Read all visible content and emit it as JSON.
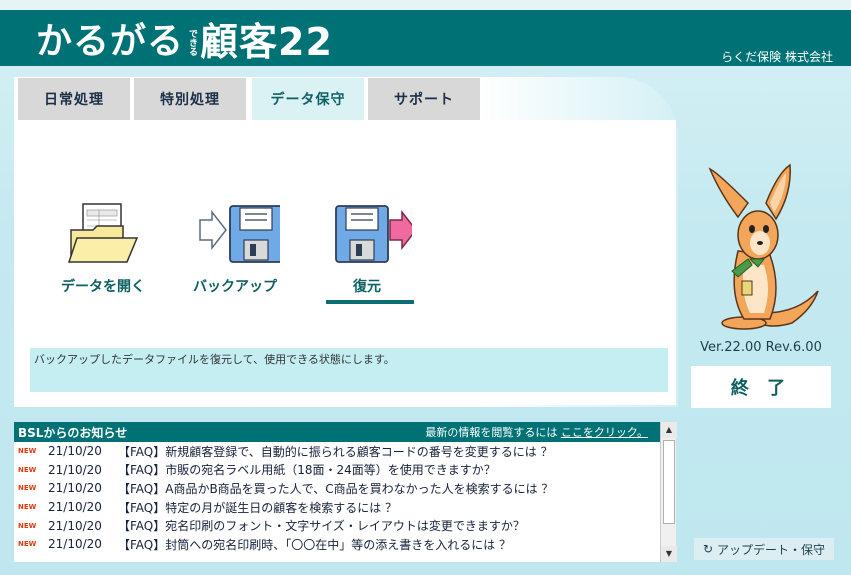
{
  "header": {
    "logo_kana": "かるがる",
    "logo_dekiru": "できる",
    "logo_kanji": "顧客22",
    "company": "らくだ保険 株式会社"
  },
  "tabs": [
    {
      "label": "日常処理"
    },
    {
      "label": "特別処理"
    },
    {
      "label": "データ保守"
    },
    {
      "label": "サポート"
    }
  ],
  "functions": {
    "open": {
      "label": "データを開く"
    },
    "backup": {
      "label": "バックアップ"
    },
    "restore": {
      "label": "復元"
    }
  },
  "description": "バックアップしたデータファイルを復元して、使用できる状態にします。",
  "side": {
    "version": "Ver.22.00 Rev.6.00",
    "exit_label": "終 了",
    "update_label": "アップデート・保守"
  },
  "news": {
    "title": "BSLからのお知らせ",
    "link_prefix": "最新の情報を閲覧するには",
    "link_text": "ここをクリック。",
    "new_badge": "NEW",
    "items": [
      {
        "date": "21/10/20",
        "title": "【FAQ】新規顧客登録で、自動的に振られる顧客コードの番号を変更するには ？"
      },
      {
        "date": "21/10/20",
        "title": "【FAQ】市販の宛名ラベル用紙（18面・24面等）を使用できますか？"
      },
      {
        "date": "21/10/20",
        "title": "【FAQ】A商品かB商品を買った人で、C商品を買わなかった人を検索するには ？"
      },
      {
        "date": "21/10/20",
        "title": "【FAQ】特定の月が誕生日の顧客を検索するには ？"
      },
      {
        "date": "21/10/20",
        "title": "【FAQ】宛名印刷のフォント・文字サイズ・レイアウトは変更できますか？"
      },
      {
        "date": "21/10/20",
        "title": "【FAQ】封筒への宛名印刷時、「〇〇在中」等の添え書きを入れるには ？"
      }
    ]
  },
  "colors": {
    "brand": "#007276",
    "accent_text": "#0c5f63",
    "tab_inactive": "#d8d8d8",
    "desc_bg": "#c4eef2"
  }
}
